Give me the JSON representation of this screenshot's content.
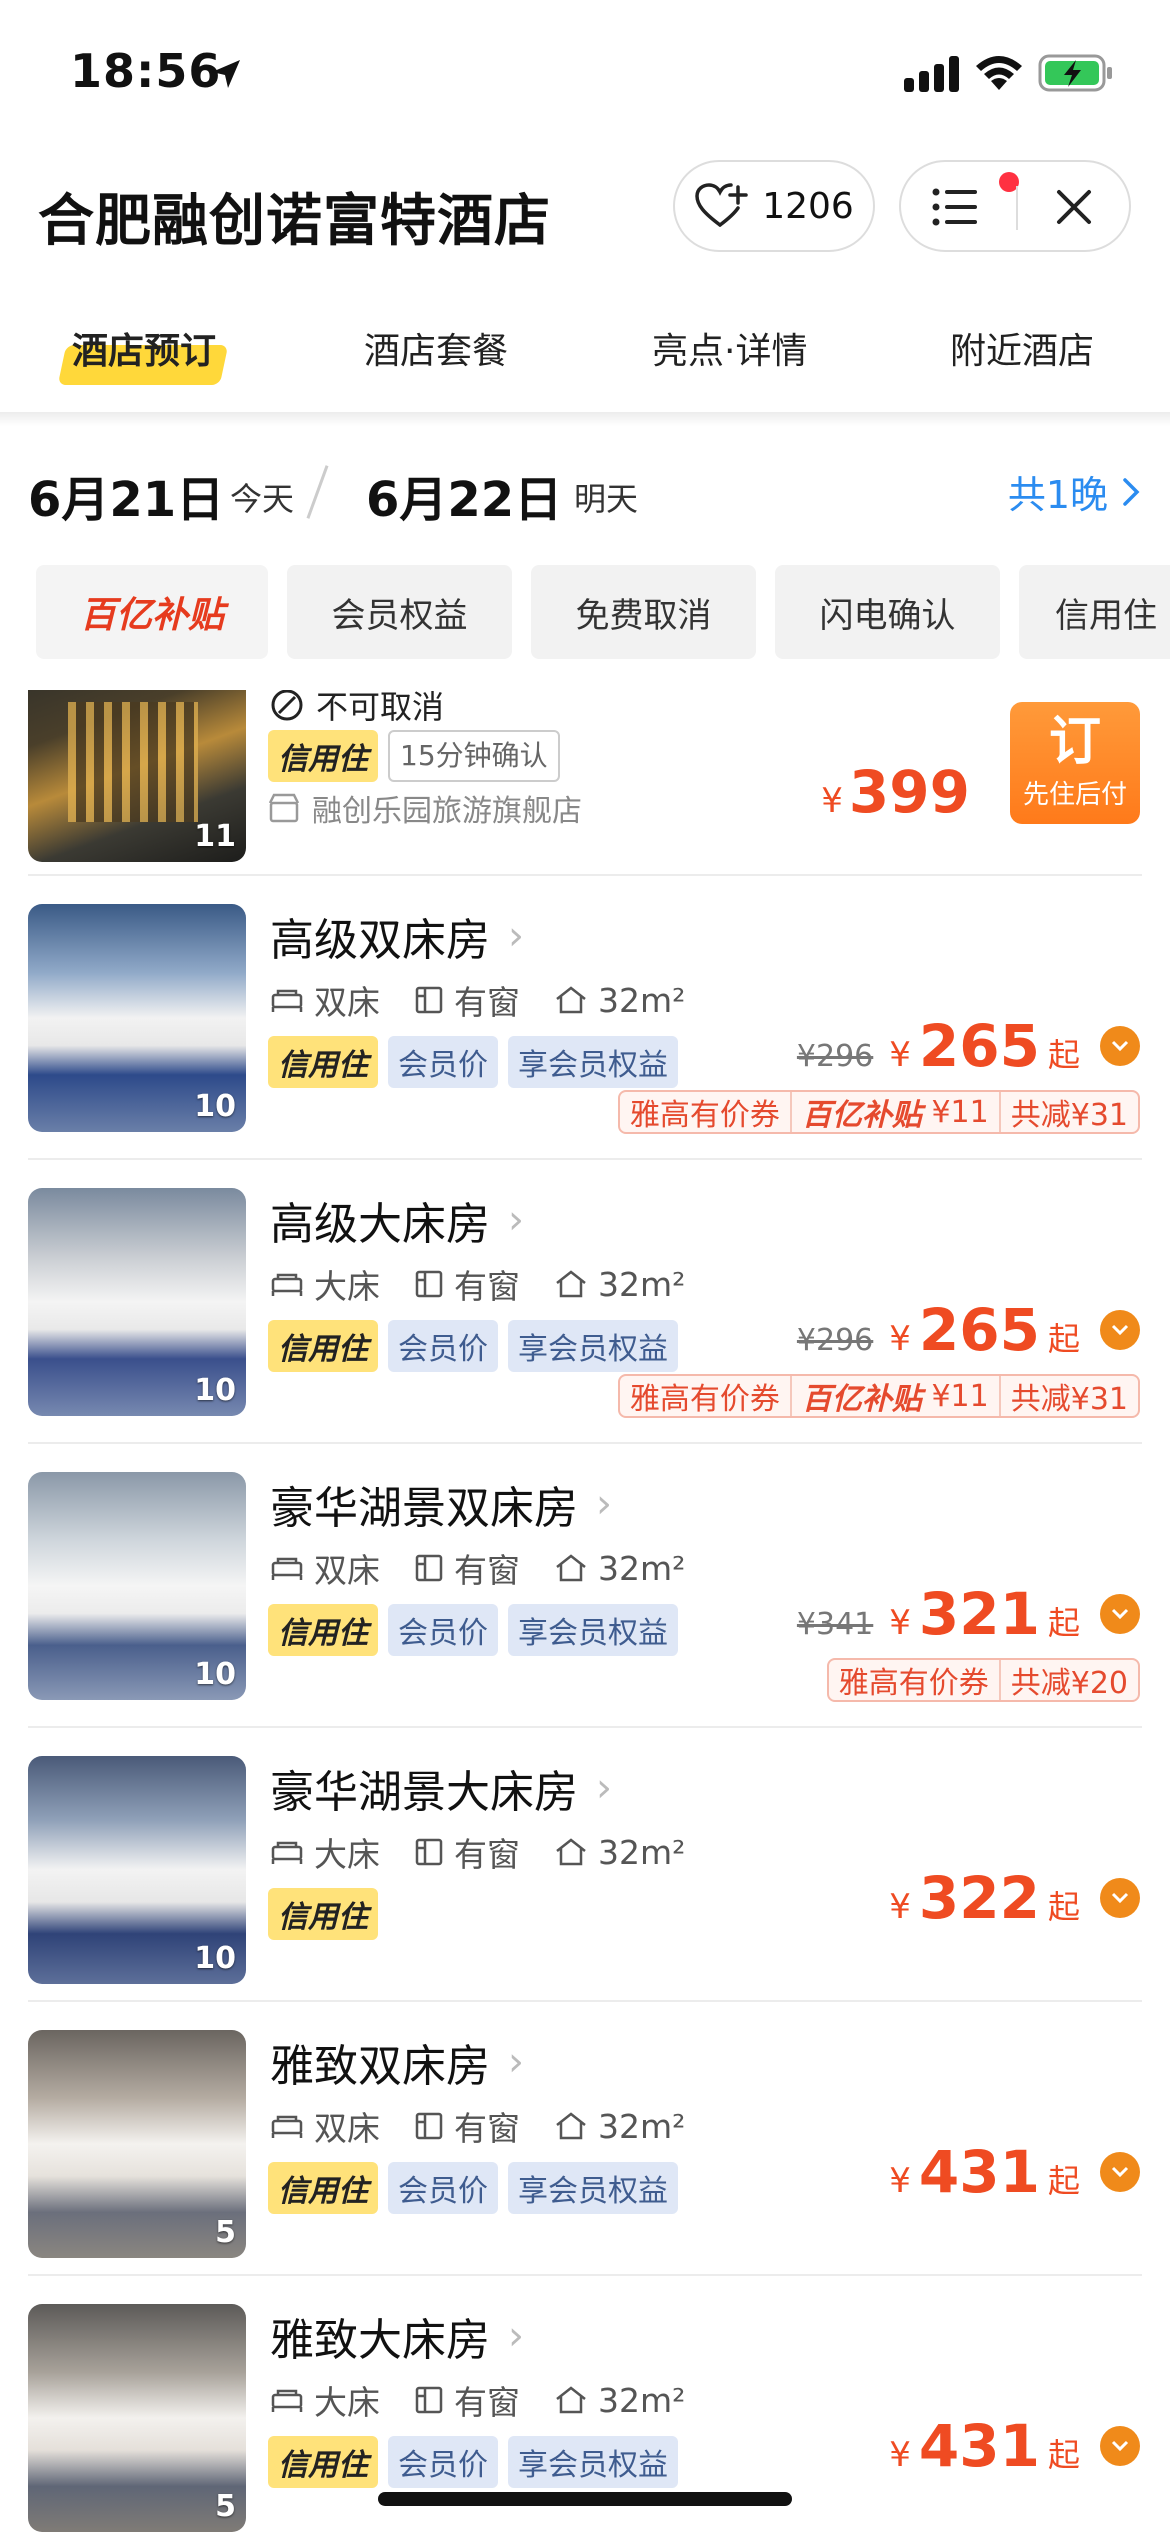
{
  "status_bar": {
    "time": "18:56"
  },
  "header": {
    "hotel_name": "合肥融创诺富特酒店",
    "favorite_count": "1206"
  },
  "tabs": [
    {
      "label": "酒店预订",
      "active": true
    },
    {
      "label": "酒店套餐",
      "active": false
    },
    {
      "label": "亮点·详情",
      "active": false
    },
    {
      "label": "附近酒店",
      "active": false
    }
  ],
  "dates": {
    "checkin": "6月21日",
    "checkin_tag": "今天",
    "checkout": "6月22日",
    "checkout_tag": "明天",
    "nights": "共1晚"
  },
  "filters": [
    "百亿补贴",
    "会员权益",
    "免费取消",
    "闪电确认",
    "信用住"
  ],
  "top_partial": {
    "cancel_text": "不可取消",
    "tag_credit": "信用住",
    "tag_confirm": "15分钟确认",
    "shop": "融创乐园旅游旗舰店",
    "photo_count": "11",
    "price": "399",
    "book_label": "订",
    "book_sub": "先住后付"
  },
  "rooms": [
    {
      "name": "高级双床房",
      "bed": "双床",
      "window": "有窗",
      "area": "32m²",
      "photos": "10",
      "tags": [
        "信用住",
        "会员价",
        "享会员权益"
      ],
      "original": "¥296",
      "price": "265",
      "promo": [
        "雅高有价券",
        "百亿补贴",
        "¥11",
        "共减¥31"
      ]
    },
    {
      "name": "高级大床房",
      "bed": "大床",
      "window": "有窗",
      "area": "32m²",
      "photos": "10",
      "tags": [
        "信用住",
        "会员价",
        "享会员权益"
      ],
      "original": "¥296",
      "price": "265",
      "promo": [
        "雅高有价券",
        "百亿补贴",
        "¥11",
        "共减¥31"
      ]
    },
    {
      "name": "豪华湖景双床房",
      "bed": "双床",
      "window": "有窗",
      "area": "32m²",
      "photos": "10",
      "tags": [
        "信用住",
        "会员价",
        "享会员权益"
      ],
      "original": "¥341",
      "price": "321",
      "promo": [
        "雅高有价券",
        "共减¥20"
      ]
    },
    {
      "name": "豪华湖景大床房",
      "bed": "大床",
      "window": "有窗",
      "area": "32m²",
      "photos": "10",
      "tags": [
        "信用住"
      ],
      "original": "",
      "price": "322",
      "promo": []
    },
    {
      "name": "雅致双床房",
      "bed": "双床",
      "window": "有窗",
      "area": "32m²",
      "photos": "5",
      "tags": [
        "信用住",
        "会员价",
        "享会员权益"
      ],
      "original": "",
      "price": "431",
      "promo": []
    },
    {
      "name": "雅致大床房",
      "bed": "大床",
      "window": "有窗",
      "area": "32m²",
      "photos": "5",
      "tags": [
        "信用住",
        "会员价",
        "享会员权益"
      ],
      "original": "",
      "price": "431",
      "promo": []
    }
  ],
  "labels": {
    "yen": "¥",
    "from": "起"
  },
  "colors": {
    "accent_price": "#ef4b22",
    "link_blue": "#2b8cf0",
    "tab_highlight": "#ffd83a"
  }
}
